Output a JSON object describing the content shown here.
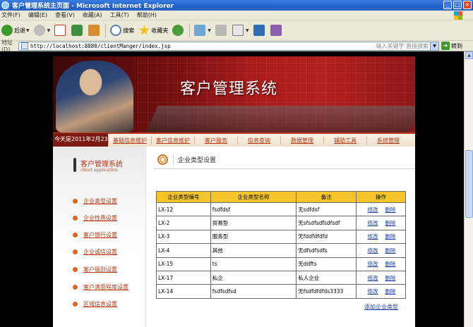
{
  "window": {
    "title": "客户管理系统主页面 - Microsoft Internet Explorer"
  },
  "menu": [
    "文件(F)",
    "编辑(E)",
    "查看(V)",
    "收藏(A)",
    "工具(T)",
    "帮助(H)"
  ],
  "toolbar": {
    "back": "后退",
    "search": "搜索",
    "favorites": "收藏夹"
  },
  "address": {
    "label": "地址(D)",
    "url": "http://localhost:8080/clientManger/index.jsp",
    "search_hint": "输入关键字 直接搜索",
    "go": "转到"
  },
  "banner": {
    "title": "客户管理系统"
  },
  "nav": {
    "date": "今天是2011年2月23日",
    "items": [
      "基础信息维护",
      "客户信息维护",
      "客户服务",
      "信息查询",
      "数据管理",
      "辅助工具",
      "系统管理"
    ]
  },
  "sidebar": {
    "title": "客户管理系统",
    "subtitle": "client application",
    "items": [
      "企业类型设置",
      "企业性质设置",
      "客户银行设置",
      "企业诚信设置",
      "客户级别设置",
      "客户满意程度设置",
      "区域信息设置"
    ]
  },
  "section": {
    "title": "企业类型设置"
  },
  "table": {
    "headers": [
      "企业类型编号",
      "企业类型名称",
      "备注",
      "操作"
    ],
    "edit_label": "修改",
    "delete_label": "删除",
    "rows": [
      [
        "LX-12",
        "fsdfdsf",
        "无sdfdsf"
      ],
      [
        "LX-2",
        "贸易型",
        "无sfsdfsdfsdfsdf"
      ],
      [
        "LX-3",
        "服务型",
        "无fddfdfdfd"
      ],
      [
        "LX-4",
        "其他",
        "无dfsdfsdfs"
      ],
      [
        "LX-15",
        "ts",
        "无ddfts"
      ],
      [
        "LX-17",
        "私企",
        "私人企业"
      ],
      [
        "LX-14",
        "fsdfsdfsd",
        "无fsdfdfdfds3333"
      ]
    ]
  },
  "add_link": "添加企业类型"
}
